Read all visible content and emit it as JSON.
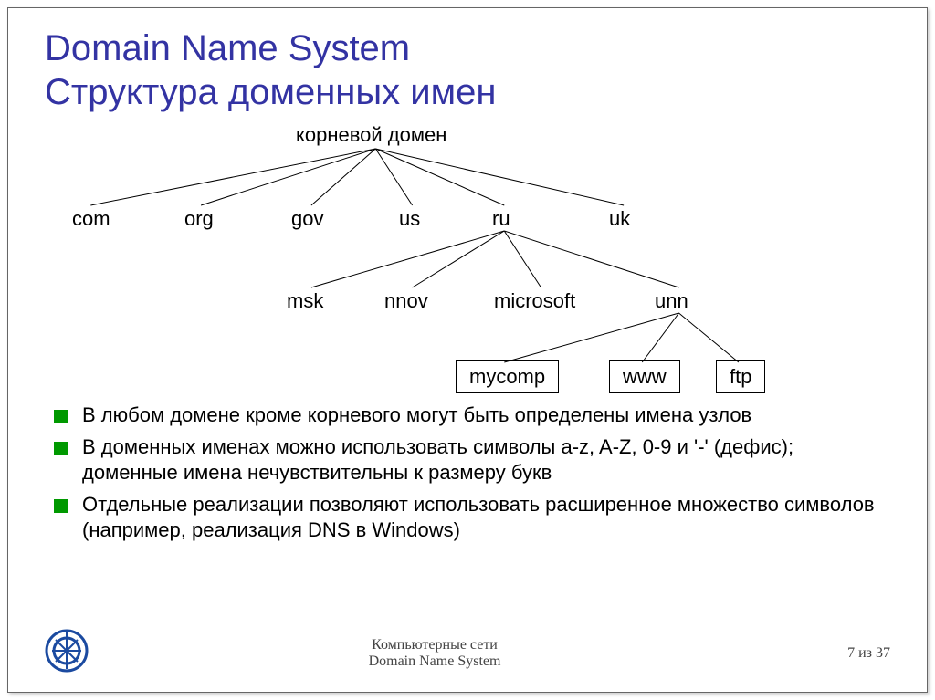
{
  "title_line1": "Domain Name System",
  "title_line2": "Структура доменных имен",
  "tree": {
    "root": "корневой домен",
    "level1": [
      "com",
      "org",
      "gov",
      "us",
      "ru",
      "uk"
    ],
    "level2_parent": "ru",
    "level2": [
      "msk",
      "nnov",
      "microsoft",
      "unn"
    ],
    "level3_parent": "unn",
    "level3": [
      "mycomp",
      "www",
      "ftp"
    ]
  },
  "bullets": [
    "В любом домене кроме корневого могут быть определены имена узлов",
    "В доменных именах можно использовать символы a-z, A-Z, 0-9 и '-' (дефис); доменные имена нечувствительны к размеру букв",
    "Отдельные реализации позволяют использовать расширенное множество символов (например, реализация DNS в Windows)"
  ],
  "footer": {
    "line1": "Компьютерные сети",
    "line2": "Domain Name System",
    "page": "7 из 37"
  },
  "colors": {
    "title": "#3333a3",
    "bullet_square": "#009900",
    "logo": "#1b4aa0"
  }
}
